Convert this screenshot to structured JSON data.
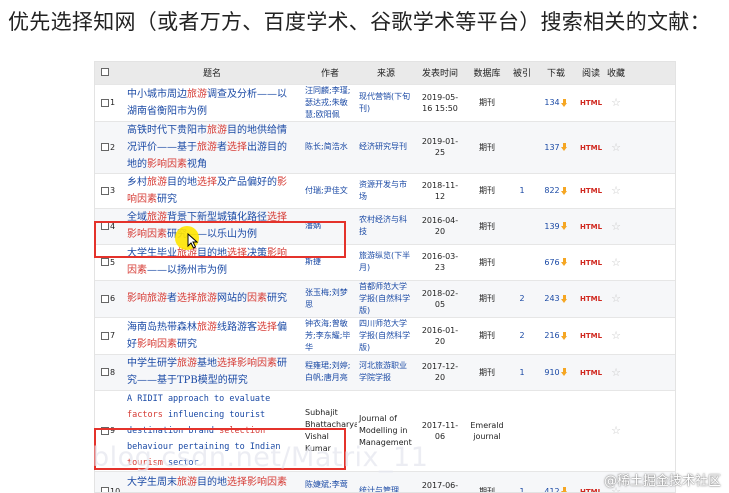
{
  "heading": "优先选择知网（或者万方、百度学术、谷歌学术等平台）搜索相关的文献：",
  "table": {
    "columns": [
      "题名",
      "作者",
      "来源",
      "发表时间",
      "数据库",
      "被引",
      "下载",
      "阅读",
      "收藏"
    ],
    "rows": [
      {
        "num": "1",
        "title_parts": [
          [
            "中小城市周边",
            false
          ],
          [
            "旅游",
            true
          ],
          [
            "调查及分析——以湖南省衡阳市为例",
            false
          ]
        ],
        "authors": "汪同麟;李瑾;瑟达戎;朱敏慧;欧阳佩",
        "source": "现代营销(下旬刊)",
        "date": "2019-05-16 15:50",
        "db": "期刊",
        "cites": "",
        "downloads": "134",
        "read": "HTML"
      },
      {
        "num": "2",
        "title_parts": [
          [
            "高铁时代下贵阳市",
            false
          ],
          [
            "旅游",
            true
          ],
          [
            "目的地供给情况评价——基于",
            false
          ],
          [
            "旅游",
            true
          ],
          [
            "者",
            false
          ],
          [
            "选择",
            true
          ],
          [
            "出游目的地的",
            false
          ],
          [
            "影响",
            true
          ],
          [
            "因素",
            true
          ],
          [
            "视角",
            false
          ]
        ],
        "authors": "陈长;简浩水",
        "source": "经济研究导刊",
        "date": "2019-01-25",
        "db": "期刊",
        "cites": "",
        "downloads": "137",
        "read": "HTML"
      },
      {
        "num": "3",
        "title_parts": [
          [
            "乡村",
            false
          ],
          [
            "旅游",
            true
          ],
          [
            "目的地",
            false
          ],
          [
            "选择",
            true
          ],
          [
            "及产品偏好的",
            false
          ],
          [
            "影响",
            true
          ],
          [
            "因素",
            true
          ],
          [
            "研究",
            false
          ]
        ],
        "authors": "付瑞;尹佳文",
        "source": "资源开发与市场",
        "date": "2018-11-12",
        "db": "期刊",
        "cites": "1",
        "downloads": "822",
        "read": "HTML"
      },
      {
        "num": "4",
        "title_parts": [
          [
            "全域",
            false
          ],
          [
            "旅游",
            true
          ],
          [
            "背景下新型城镇化路径",
            false
          ],
          [
            "选择",
            true
          ],
          [
            "影响",
            true
          ],
          [
            "因素",
            true
          ],
          [
            "研究——以乐山为例",
            false
          ]
        ],
        "authors": "潘娲",
        "source": "农村经济与科技",
        "date": "2016-04-20",
        "db": "期刊",
        "cites": "",
        "downloads": "139",
        "read": "HTML"
      },
      {
        "num": "5",
        "title_parts": [
          [
            "大学生毕业",
            false
          ],
          [
            "旅游",
            true
          ],
          [
            "目的地",
            false
          ],
          [
            "选择",
            true
          ],
          [
            "决策",
            false
          ],
          [
            "影响",
            true
          ],
          [
            "因素",
            true
          ],
          [
            "——以扬州市为例",
            false
          ]
        ],
        "authors": "斯捷",
        "source": "旅游纵览(下半月)",
        "date": "2016-03-23",
        "db": "期刊",
        "cites": "",
        "downloads": "676",
        "read": "HTML"
      },
      {
        "num": "6",
        "title_parts": [
          [
            "影响",
            true
          ],
          [
            "旅游",
            true
          ],
          [
            "者",
            false
          ],
          [
            "选择",
            true
          ],
          [
            "旅游",
            true
          ],
          [
            "网站的",
            false
          ],
          [
            "因素",
            true
          ],
          [
            "研究",
            false
          ]
        ],
        "authors": "张玉梅;刘梦思",
        "source": "首都师范大学学报(自然科学版)",
        "date": "2018-02-05",
        "db": "期刊",
        "cites": "2",
        "downloads": "243",
        "read": "HTML"
      },
      {
        "num": "7",
        "title_parts": [
          [
            "海南岛热带森林",
            false
          ],
          [
            "旅游",
            true
          ],
          [
            "线路游客",
            false
          ],
          [
            "选择",
            true
          ],
          [
            "偏好",
            false
          ],
          [
            "影响",
            true
          ],
          [
            "因素",
            true
          ],
          [
            "研究",
            false
          ]
        ],
        "authors": "钟衣海;曾敏芳;李东耀;毕华",
        "source": "四川师范大学学报(自然科学版)",
        "date": "2016-01-20",
        "db": "期刊",
        "cites": "2",
        "downloads": "216",
        "read": "HTML"
      },
      {
        "num": "8",
        "title_parts": [
          [
            "中学生研学",
            false
          ],
          [
            "旅游",
            true
          ],
          [
            "基地",
            false
          ],
          [
            "选择",
            true
          ],
          [
            "影响",
            true
          ],
          [
            "因素",
            true
          ],
          [
            "研究——基于TPB模型的研究",
            false
          ]
        ],
        "authors": "程雍珺;刘婷;白帆;唐月亮",
        "source": "河北旅游职业学院学报",
        "date": "2017-12-20",
        "db": "期刊",
        "cites": "1",
        "downloads": "910",
        "read": "HTML"
      },
      {
        "num": "9",
        "title_parts": [
          [
            "A RIDIT approach to evaluate ",
            false
          ],
          [
            "factors",
            true
          ],
          [
            " influencing tourist destination brand ",
            false
          ],
          [
            "selection",
            true
          ],
          [
            " behaviour pertaining to Indian ",
            false
          ],
          [
            "tourism",
            true
          ],
          [
            " sector",
            false
          ]
        ],
        "authors": "Subhajit Bhattacharya;;Rohit Vishal Kumar",
        "source": "Journal of Modelling in Management",
        "date": "2017-11-06",
        "db": "Emerald journal",
        "cites": "",
        "downloads": "",
        "read": ""
      },
      {
        "num": "10",
        "title_parts": [
          [
            "大学生周末",
            false
          ],
          [
            "旅游",
            true
          ],
          [
            "目的地",
            false
          ],
          [
            "选择",
            true
          ],
          [
            "影响",
            true
          ],
          [
            "因素",
            true
          ],
          [
            "研究——以广州为例",
            false
          ]
        ],
        "authors": "陈婕斌;李莺翠",
        "source": "统计与管理",
        "date": "2017-06-20",
        "db": "期刊",
        "cites": "1",
        "downloads": "412",
        "read": "HTML"
      }
    ]
  },
  "watermark_url": "blog.csdn.net/Matrix_11",
  "watermark_brand": "@稀土掘金技术社区",
  "colors": {
    "link": "#1b4aa5",
    "highlight": "#d63c36",
    "box": "#e4322b",
    "html_badge": "#d0281f",
    "download_icon": "#f5a623"
  }
}
